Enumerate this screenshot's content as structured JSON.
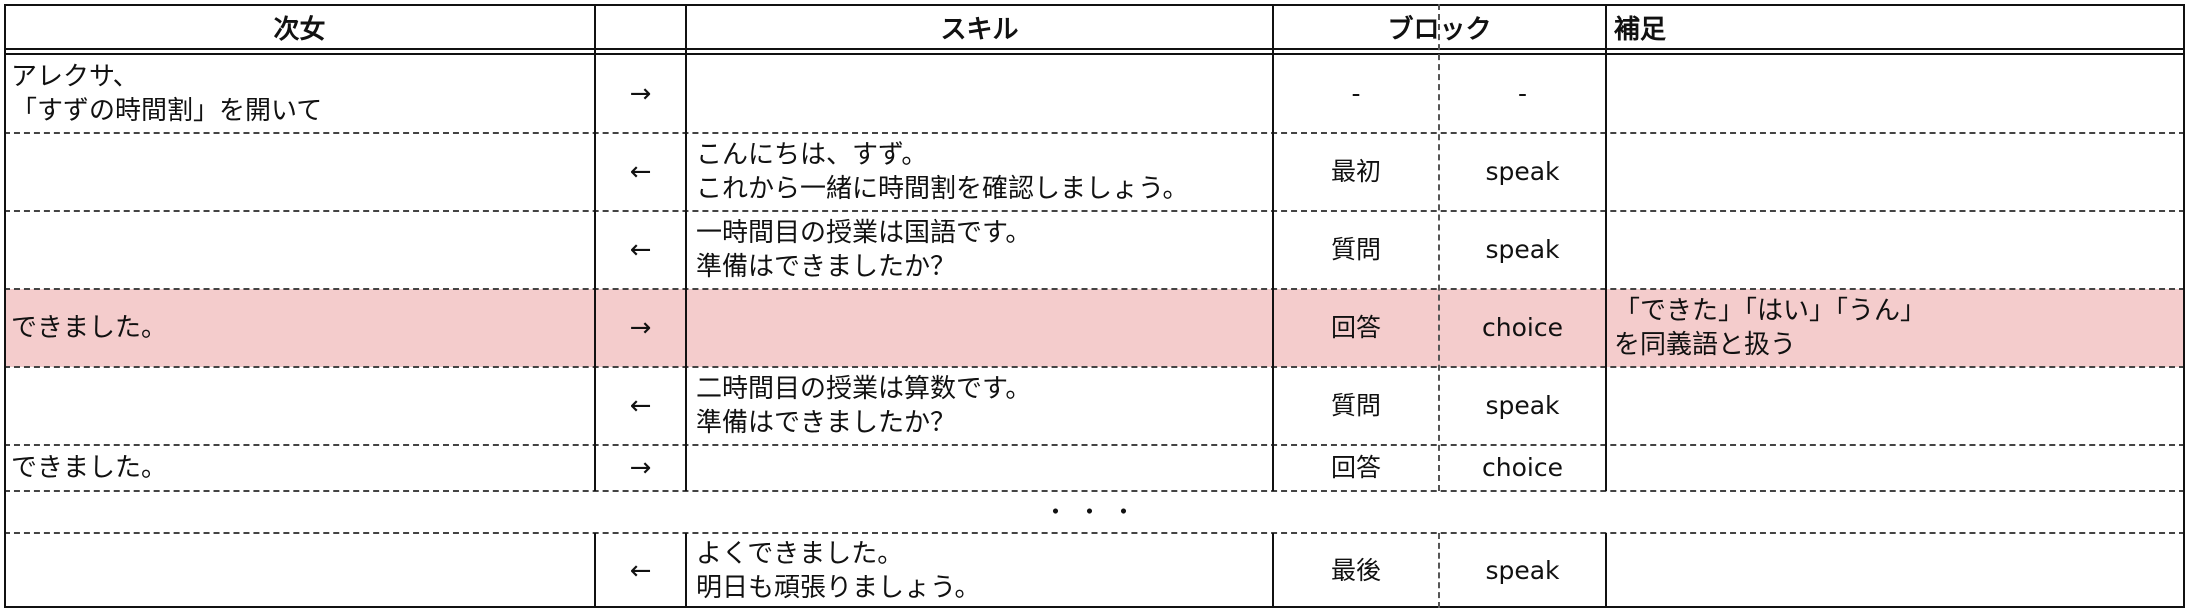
{
  "header": {
    "girl": "次女",
    "arrow": "",
    "skill": "スキル",
    "block": "ブロック",
    "note": "補足"
  },
  "rows": [
    {
      "girl": "アレクサ、\n「すずの時間割」を開いて",
      "arrow": "→",
      "skill": "",
      "block_phase": "-",
      "block_type": "-",
      "note": ""
    },
    {
      "girl": "",
      "arrow": "←",
      "skill": "こんにちは、すず。\nこれから一緒に時間割を確認しましょう。",
      "block_phase": "最初",
      "block_type": "speak",
      "note": ""
    },
    {
      "girl": "",
      "arrow": "←",
      "skill": "一時間目の授業は国語です。\n準備はできましたか？",
      "block_phase": "質問",
      "block_type": "speak",
      "note": ""
    },
    {
      "girl": "できました。",
      "arrow": "→",
      "skill": "",
      "block_phase": "回答",
      "block_type": "choice",
      "note": "「できた」「はい」「うん」\nを同義語と扱う"
    },
    {
      "girl": "",
      "arrow": "←",
      "skill": "二時間目の授業は算数です。\n準備はできましたか？",
      "block_phase": "質問",
      "block_type": "speak",
      "note": ""
    },
    {
      "girl": "できました。",
      "arrow": "→",
      "skill": "",
      "block_phase": "回答",
      "block_type": "choice",
      "note": ""
    },
    {
      "girl": "",
      "arrow": "←",
      "skill": "よくできました。\n明日も頑張りましょう。",
      "block_phase": "最後",
      "block_type": "speak",
      "note": ""
    }
  ],
  "ellipsis": "・・・",
  "colors": {
    "highlight_row": "#f4cccc",
    "border": "#111111"
  }
}
